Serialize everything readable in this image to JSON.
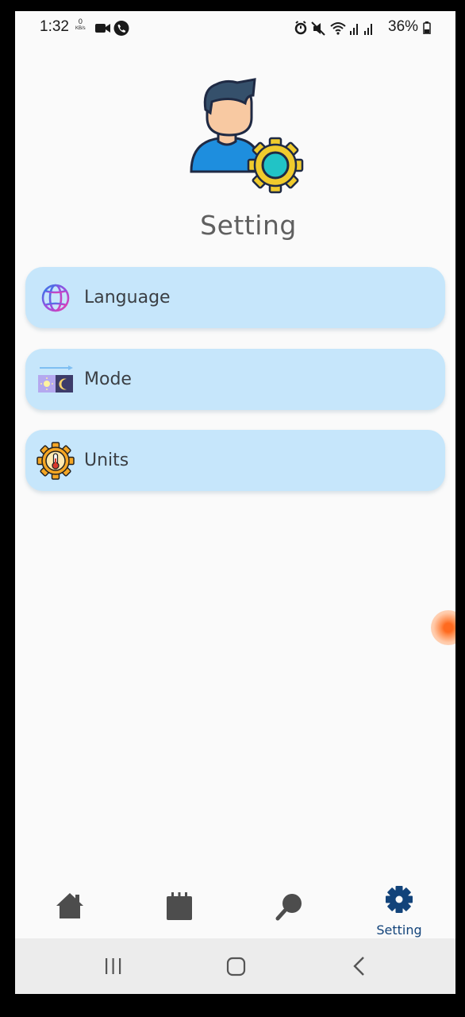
{
  "status_bar": {
    "time": "1:32",
    "kbs_value": "0",
    "kbs_unit": "KB/s",
    "battery": "36%"
  },
  "page": {
    "title": "Setting"
  },
  "menu": {
    "items": [
      {
        "label": "Language",
        "icon": "globe-icon"
      },
      {
        "label": "Mode",
        "icon": "day-night-mode-icon"
      },
      {
        "label": "Units",
        "icon": "thermometer-gear-icon"
      }
    ]
  },
  "bottom_nav": {
    "items": [
      {
        "icon": "home-icon",
        "label": ""
      },
      {
        "icon": "calendar-icon",
        "label": ""
      },
      {
        "icon": "search-icon",
        "label": ""
      },
      {
        "icon": "gear-icon",
        "label": "Setting",
        "active": true
      }
    ]
  },
  "colors": {
    "menu_background": "#c6e6fb",
    "active_nav": "#12437a",
    "inactive_nav": "#4d4d4d",
    "title_text": "#5f5f5f"
  }
}
